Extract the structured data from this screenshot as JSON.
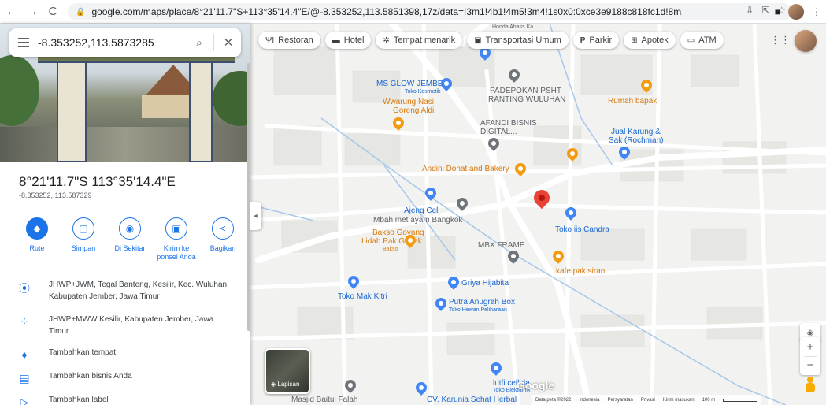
{
  "browser": {
    "back": "←",
    "forward": "→",
    "reload": "C",
    "url": "google.com/maps/place/8°21'11.7\"S+113°35'14.4\"E/@-8.353252,113.5851398,17z/data=!3m1!4b1!4m5!3m4!1s0x0:0xce3e9188c818fc1d!8m2!3d-8.353252!4d113.5..."
  },
  "search": {
    "value": "-8.353252,113.5873285"
  },
  "place": {
    "title": "8°21'11.7\"S 113°35'14.4\"E",
    "subtitle": "-8.353252, 113.587329"
  },
  "actions": [
    {
      "label": "Rute",
      "icon": "◆"
    },
    {
      "label": "Simpan",
      "icon": "▢"
    },
    {
      "label": "Di Sekitar",
      "icon": "◉"
    },
    {
      "label": "Kirim ke ponsel Anda",
      "icon": "▣"
    },
    {
      "label": "Bagikan",
      "icon": "<"
    }
  ],
  "info": [
    {
      "icon": "⦿",
      "text": "JHWP+JWM, Tegal Banteng, Kesilir, Kec. Wuluhan, Kabupaten Jember, Jawa Timur"
    },
    {
      "icon": "⁘",
      "text": "JHWP+MWW Kesilir, Kabupaten Jember, Jawa Timur"
    },
    {
      "icon": "♦",
      "text": "Tambahkan tempat"
    },
    {
      "icon": "▤",
      "text": "Tambahkan bisnis Anda"
    },
    {
      "icon": "▷",
      "text": "Tambahkan label"
    }
  ],
  "chips": [
    {
      "label": "Restoran",
      "icon": "ΨΙ"
    },
    {
      "label": "Hotel",
      "icon": "▬"
    },
    {
      "label": "Tempat menarik",
      "icon": "✲"
    },
    {
      "label": "Transportasi Umum",
      "icon": "▣"
    },
    {
      "label": "Parkir",
      "icon": "P"
    },
    {
      "label": "Apotek",
      "icon": "⊞"
    },
    {
      "label": "ATM",
      "icon": "▭"
    }
  ],
  "poi": {
    "ms_glow": "MS GLOW JEMBER",
    "toko_kosmetik": "Toko Kosmetik",
    "wwarung1": "Wwarung Nasi",
    "wwarung2": "Goreng Aldi",
    "padepokan1": "PADEPOKAN PSHT",
    "padepokan2": "RANTING WULUHAN",
    "rumah_bapak": "Rumah bapak",
    "afandi1": "AFANDI BISNIS",
    "afandi2": "DIGITAL...",
    "jual1": "Jual Karung &",
    "jual2": "Sak (Rochman)",
    "andini": "Andini Donat and Bakery",
    "ajeng": "Ajeng Cell",
    "mbah": "Mbah met ayam Bangkok",
    "bakso1": "Bakso Goyang",
    "bakso2": "Lidah Pak Godek",
    "bakso3": "Bakso",
    "toko_iis": "Toko iis Candra",
    "mbx": "MBX FRAME",
    "kafe": "kafe pak siran",
    "griya": "Griya Hijabita",
    "mak_kitri": "Toko Mak Kitri",
    "putra1": "Putra Anugrah Box",
    "putra2": "Toko Hewan Peliharaan",
    "lutfi1": "lutfi cellula",
    "lutfi2": "Toko Elektronik",
    "masjid": "Masjid Baitul Falah",
    "karunia": "CV. Karunia Sehat Herbal",
    "top_label": "Honda Ahass Ka..."
  },
  "map": {
    "layers_label": "Lapisan",
    "google": "Google",
    "attrib": [
      "Data peta ©2022",
      "Indonesia",
      "Persyaratan",
      "Privasi",
      "Kirim masukan",
      "100 m"
    ]
  },
  "colors": {
    "accent": "#1a73e8",
    "pin": "#ea4335"
  }
}
